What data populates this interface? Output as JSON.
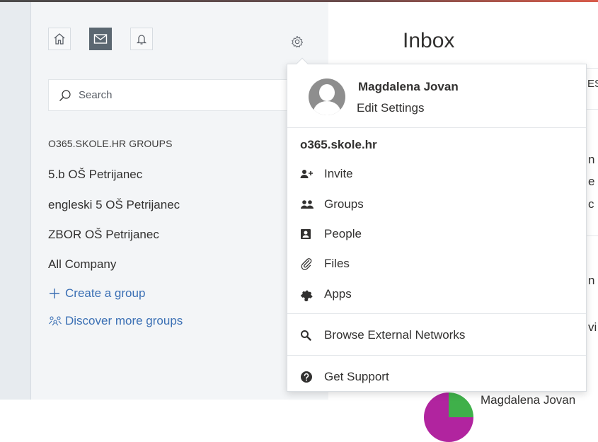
{
  "sidebar": {
    "search_placeholder": "Search",
    "groups_header": "O365.SKOLE.HR GROUPS",
    "groups": [
      "5.b OŠ Petrijanec",
      "engleski 5 OŠ Petrijanec",
      "ZBOR OŠ Petrijanec",
      "All Company"
    ],
    "create_group": "Create a group",
    "discover_groups": "Discover more groups"
  },
  "main": {
    "title": "Inbox",
    "fragments": [
      "ES",
      "n",
      "e",
      "c",
      "n",
      "vi"
    ],
    "bottom_name": "Magdalena Jovan"
  },
  "menu": {
    "profile_name": "Magdalena Jovan",
    "edit_settings": "Edit Settings",
    "network": "o365.skole.hr",
    "invite": "Invite",
    "groups": "Groups",
    "people": "People",
    "files": "Files",
    "apps": "Apps",
    "browse": "Browse External Networks",
    "support": "Get Support"
  },
  "colors": {
    "link": "#3a6fb4",
    "active_tab": "#5b6771",
    "sidebar_bg": "#f3f5f7"
  },
  "icons": [
    "home-icon",
    "mail-icon",
    "bell-icon",
    "gear-icon",
    "search-icon",
    "plus-icon",
    "discover-icon",
    "invite-icon",
    "groups-icon",
    "people-icon",
    "paperclip-icon",
    "puzzle-icon",
    "search-icon",
    "help-icon"
  ]
}
